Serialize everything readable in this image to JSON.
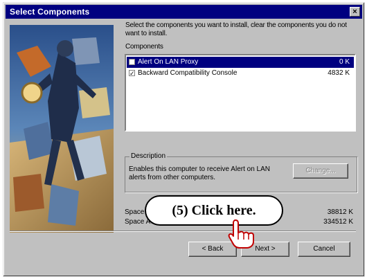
{
  "window": {
    "title": "Select Components",
    "close_glyph": "×"
  },
  "instructions": "Select the components you want to install, clear the components you do not want to install.",
  "components": {
    "label": "Components",
    "items": [
      {
        "name": "Alert On LAN Proxy",
        "size": "0 K",
        "checked": false,
        "selected": true
      },
      {
        "name": "Backward Compatibility Console",
        "size": "4832 K",
        "checked": true,
        "selected": false
      }
    ]
  },
  "description": {
    "label": "Description",
    "text": "Enables this computer to receive Alert on LAN alerts from other computers.",
    "change_button": "Change..."
  },
  "space": {
    "required_label": "Space Required:",
    "required_value": "38812 K",
    "available_label": "Space Available:",
    "available_value": "334512 K"
  },
  "buttons": {
    "back": "< Back",
    "next": "Next >",
    "cancel": "Cancel"
  },
  "callout": {
    "text": "(5)  Click here."
  },
  "icons": {
    "pointer": "pointing-hand-icon",
    "checkbox": "checkbox-icon"
  },
  "colors": {
    "titlebar": "#000080",
    "selection": "#000080",
    "face": "#c0c0c0"
  }
}
